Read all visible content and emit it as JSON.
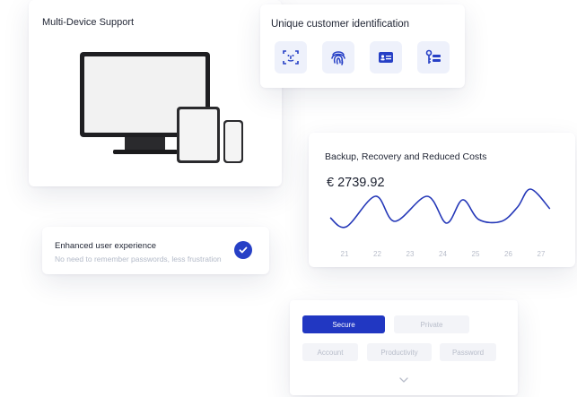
{
  "multi_device": {
    "title": "Multi-Device Support"
  },
  "identification": {
    "title": "Unique customer identification",
    "icons": [
      "face-scan-icon",
      "fingerprint-icon",
      "id-card-icon",
      "key-list-icon"
    ],
    "accent": "#2740c6",
    "tile_bg": "#eef1fb"
  },
  "backup": {
    "title": "Backup, Recovery and Reduced Costs",
    "amount": "€ 2739.92",
    "chart_data": {
      "type": "line",
      "x": [
        "21",
        "22",
        "23",
        "24",
        "25",
        "26",
        "27"
      ],
      "series": [
        {
          "values": [
            50,
            45,
            62,
            48,
            62,
            47,
            60,
            49,
            48,
            56,
            66,
            55
          ]
        }
      ],
      "x_points": [
        0,
        0.5,
        1.4,
        2.0,
        3.0,
        3.6,
        4.1,
        4.6,
        5.3,
        5.8,
        6.2,
        6.8
      ],
      "color": "#2538b8"
    }
  },
  "ux": {
    "title": "Enhanced user experience",
    "subtitle": "No need to remember passwords, less frustration"
  },
  "tags": {
    "row1": [
      "Secure",
      "Private"
    ],
    "row2": [
      "Account",
      "Productivity",
      "Password"
    ],
    "selected": "Secure"
  }
}
